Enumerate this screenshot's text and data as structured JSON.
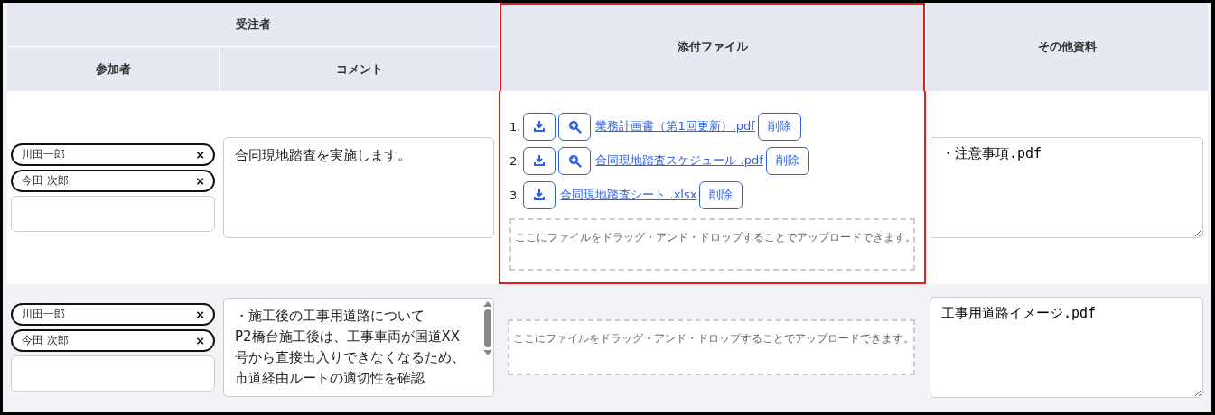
{
  "header": {
    "group": "受注者",
    "participants": "参加者",
    "comment": "コメント",
    "attachments": "添付ファイル",
    "other": "その他資料"
  },
  "rows": [
    {
      "participants": [
        {
          "name": "川田一郎",
          "remove": "×"
        },
        {
          "name": "今田 次郎",
          "remove": "×"
        }
      ],
      "comment_lines": [
        "合同現地踏査を実施します。"
      ],
      "comment_scrollbar": false,
      "files": [
        {
          "number": "1.",
          "previewable": true,
          "name": "業務計画書（第1回更新）.pdf",
          "delete": "削除"
        },
        {
          "number": "2.",
          "previewable": true,
          "name": "合同現地踏査スケジュール .pdf",
          "delete": "削除"
        },
        {
          "number": "3.",
          "previewable": false,
          "name": "合同現地踏査シート .xlsx",
          "delete": "削除"
        }
      ],
      "dropzone": "ここにファイルをドラッグ・アンド・ドロップすることでアップロードできます。",
      "other": "・注意事項.pdf",
      "highlighted": true
    },
    {
      "participants": [
        {
          "name": "川田一郎",
          "remove": "×"
        },
        {
          "name": "今田 次郎",
          "remove": "×"
        }
      ],
      "comment_lines": [
        "・施工後の工事用道路について",
        "P2橋台施工後は、工事車両が国道XX号から直接出入りできなくなるため、市道経由ルートの適切性を確認"
      ],
      "comment_scrollbar": true,
      "files": [],
      "dropzone": "ここにファイルをドラッグ・アンド・ドロップすることでアップロードできます。",
      "other": "工事用道路イメージ.pdf",
      "highlighted": false
    }
  ]
}
